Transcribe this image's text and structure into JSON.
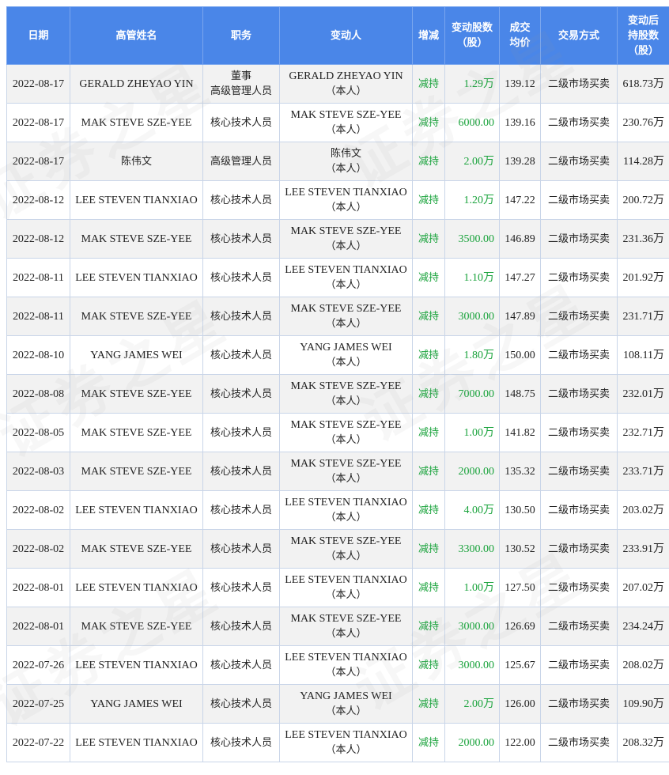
{
  "header": {
    "date": "日期",
    "name": "高管姓名",
    "position": "职务",
    "changer": "变动人",
    "direction": "增减",
    "shares": [
      "变动股数",
      "（股）"
    ],
    "price": [
      "成交",
      "均价"
    ],
    "method": "交易方式",
    "holding": [
      "变动后",
      "持股数",
      "（股）"
    ]
  },
  "rows": [
    {
      "date": "2022-08-17",
      "name": "GERALD ZHEYAO YIN",
      "position": [
        "董事",
        "高级管理人员"
      ],
      "changer": [
        "GERALD ZHEYAO YIN",
        "（本人）"
      ],
      "direction": "减持",
      "shares": "1.29万",
      "price": "139.12",
      "method": "二级市场买卖",
      "holding": "618.73万"
    },
    {
      "date": "2022-08-17",
      "name": "MAK STEVE SZE-YEE",
      "position": [
        "核心技术人员"
      ],
      "changer": [
        "MAK STEVE SZE-YEE",
        "（本人）"
      ],
      "direction": "减持",
      "shares": "6000.00",
      "price": "139.16",
      "method": "二级市场买卖",
      "holding": "230.76万"
    },
    {
      "date": "2022-08-17",
      "name": "陈伟文",
      "position": [
        "高级管理人员"
      ],
      "changer": [
        "陈伟文",
        "（本人）"
      ],
      "direction": "减持",
      "shares": "2.00万",
      "price": "139.28",
      "method": "二级市场买卖",
      "holding": "114.28万"
    },
    {
      "date": "2022-08-12",
      "name": "LEE STEVEN TIANXIAO",
      "position": [
        "核心技术人员"
      ],
      "changer": [
        "LEE STEVEN TIANXIAO",
        "（本人）"
      ],
      "direction": "减持",
      "shares": "1.20万",
      "price": "147.22",
      "method": "二级市场买卖",
      "holding": "200.72万"
    },
    {
      "date": "2022-08-12",
      "name": "MAK STEVE SZE-YEE",
      "position": [
        "核心技术人员"
      ],
      "changer": [
        "MAK STEVE SZE-YEE",
        "（本人）"
      ],
      "direction": "减持",
      "shares": "3500.00",
      "price": "146.89",
      "method": "二级市场买卖",
      "holding": "231.36万"
    },
    {
      "date": "2022-08-11",
      "name": "LEE STEVEN TIANXIAO",
      "position": [
        "核心技术人员"
      ],
      "changer": [
        "LEE STEVEN TIANXIAO",
        "（本人）"
      ],
      "direction": "减持",
      "shares": "1.10万",
      "price": "147.27",
      "method": "二级市场买卖",
      "holding": "201.92万"
    },
    {
      "date": "2022-08-11",
      "name": "MAK STEVE SZE-YEE",
      "position": [
        "核心技术人员"
      ],
      "changer": [
        "MAK STEVE SZE-YEE",
        "（本人）"
      ],
      "direction": "减持",
      "shares": "3000.00",
      "price": "147.89",
      "method": "二级市场买卖",
      "holding": "231.71万"
    },
    {
      "date": "2022-08-10",
      "name": "YANG JAMES WEI",
      "position": [
        "核心技术人员"
      ],
      "changer": [
        "YANG JAMES WEI",
        "（本人）"
      ],
      "direction": "减持",
      "shares": "1.80万",
      "price": "150.00",
      "method": "二级市场买卖",
      "holding": "108.11万"
    },
    {
      "date": "2022-08-08",
      "name": "MAK STEVE SZE-YEE",
      "position": [
        "核心技术人员"
      ],
      "changer": [
        "MAK STEVE SZE-YEE",
        "（本人）"
      ],
      "direction": "减持",
      "shares": "7000.00",
      "price": "148.75",
      "method": "二级市场买卖",
      "holding": "232.01万"
    },
    {
      "date": "2022-08-05",
      "name": "MAK STEVE SZE-YEE",
      "position": [
        "核心技术人员"
      ],
      "changer": [
        "MAK STEVE SZE-YEE",
        "（本人）"
      ],
      "direction": "减持",
      "shares": "1.00万",
      "price": "141.82",
      "method": "二级市场买卖",
      "holding": "232.71万"
    },
    {
      "date": "2022-08-03",
      "name": "MAK STEVE SZE-YEE",
      "position": [
        "核心技术人员"
      ],
      "changer": [
        "MAK STEVE SZE-YEE",
        "（本人）"
      ],
      "direction": "减持",
      "shares": "2000.00",
      "price": "135.32",
      "method": "二级市场买卖",
      "holding": "233.71万"
    },
    {
      "date": "2022-08-02",
      "name": "LEE STEVEN TIANXIAO",
      "position": [
        "核心技术人员"
      ],
      "changer": [
        "LEE STEVEN TIANXIAO",
        "（本人）"
      ],
      "direction": "减持",
      "shares": "4.00万",
      "price": "130.50",
      "method": "二级市场买卖",
      "holding": "203.02万"
    },
    {
      "date": "2022-08-02",
      "name": "MAK STEVE SZE-YEE",
      "position": [
        "核心技术人员"
      ],
      "changer": [
        "MAK STEVE SZE-YEE",
        "（本人）"
      ],
      "direction": "减持",
      "shares": "3300.00",
      "price": "130.52",
      "method": "二级市场买卖",
      "holding": "233.91万"
    },
    {
      "date": "2022-08-01",
      "name": "LEE STEVEN TIANXIAO",
      "position": [
        "核心技术人员"
      ],
      "changer": [
        "LEE STEVEN TIANXIAO",
        "（本人）"
      ],
      "direction": "减持",
      "shares": "1.00万",
      "price": "127.50",
      "method": "二级市场买卖",
      "holding": "207.02万"
    },
    {
      "date": "2022-08-01",
      "name": "MAK STEVE SZE-YEE",
      "position": [
        "核心技术人员"
      ],
      "changer": [
        "MAK STEVE SZE-YEE",
        "（本人）"
      ],
      "direction": "减持",
      "shares": "3000.00",
      "price": "126.69",
      "method": "二级市场买卖",
      "holding": "234.24万"
    },
    {
      "date": "2022-07-26",
      "name": "LEE STEVEN TIANXIAO",
      "position": [
        "核心技术人员"
      ],
      "changer": [
        "LEE STEVEN TIANXIAO",
        "（本人）"
      ],
      "direction": "减持",
      "shares": "3000.00",
      "price": "125.67",
      "method": "二级市场买卖",
      "holding": "208.02万"
    },
    {
      "date": "2022-07-25",
      "name": "YANG JAMES WEI",
      "position": [
        "核心技术人员"
      ],
      "changer": [
        "YANG JAMES WEI",
        "（本人）"
      ],
      "direction": "减持",
      "shares": "2.00万",
      "price": "126.00",
      "method": "二级市场买卖",
      "holding": "109.90万"
    },
    {
      "date": "2022-07-22",
      "name": "LEE STEVEN TIANXIAO",
      "position": [
        "核心技术人员"
      ],
      "changer": [
        "LEE STEVEN TIANXIAO",
        "（本人）"
      ],
      "direction": "减持",
      "shares": "2000.00",
      "price": "122.00",
      "method": "二级市场买卖",
      "holding": "208.32万"
    }
  ],
  "watermark": "证券之星",
  "colors": {
    "header_bg": "#4a86e8",
    "decrease": "#1aa33c",
    "stripe": "#f2f2f2"
  }
}
